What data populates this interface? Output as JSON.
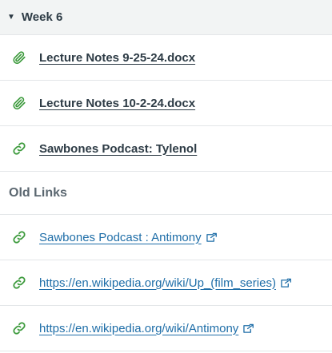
{
  "module": {
    "title": "Week 6",
    "caret_icon": "caret-down-icon",
    "items": [
      {
        "icon": "paperclip-icon",
        "title": "Lecture Notes 9-25-24.docx"
      },
      {
        "icon": "paperclip-icon",
        "title": "Lecture Notes 10-2-24.docx"
      },
      {
        "icon": "link-icon",
        "title": "Sawbones Podcast: Tylenol"
      }
    ],
    "subheader": "Old Links",
    "external_links": [
      {
        "icon": "link-icon",
        "title": "Sawbones Podcast : Antimony",
        "external_icon": "external-link-icon"
      },
      {
        "icon": "link-icon",
        "title": "https://en.wikipedia.org/wiki/Up_(film_series)",
        "external_icon": "external-link-icon"
      },
      {
        "icon": "link-icon",
        "title": "https://en.wikipedia.org/wiki/Antimony",
        "external_icon": "external-link-icon"
      }
    ]
  },
  "colors": {
    "text": "#2d3b45",
    "icon_green": "#3c9a3c",
    "link_blue": "#1f6ea8",
    "header_bg": "#f2f4f4",
    "subheader_text": "#5b6770"
  }
}
